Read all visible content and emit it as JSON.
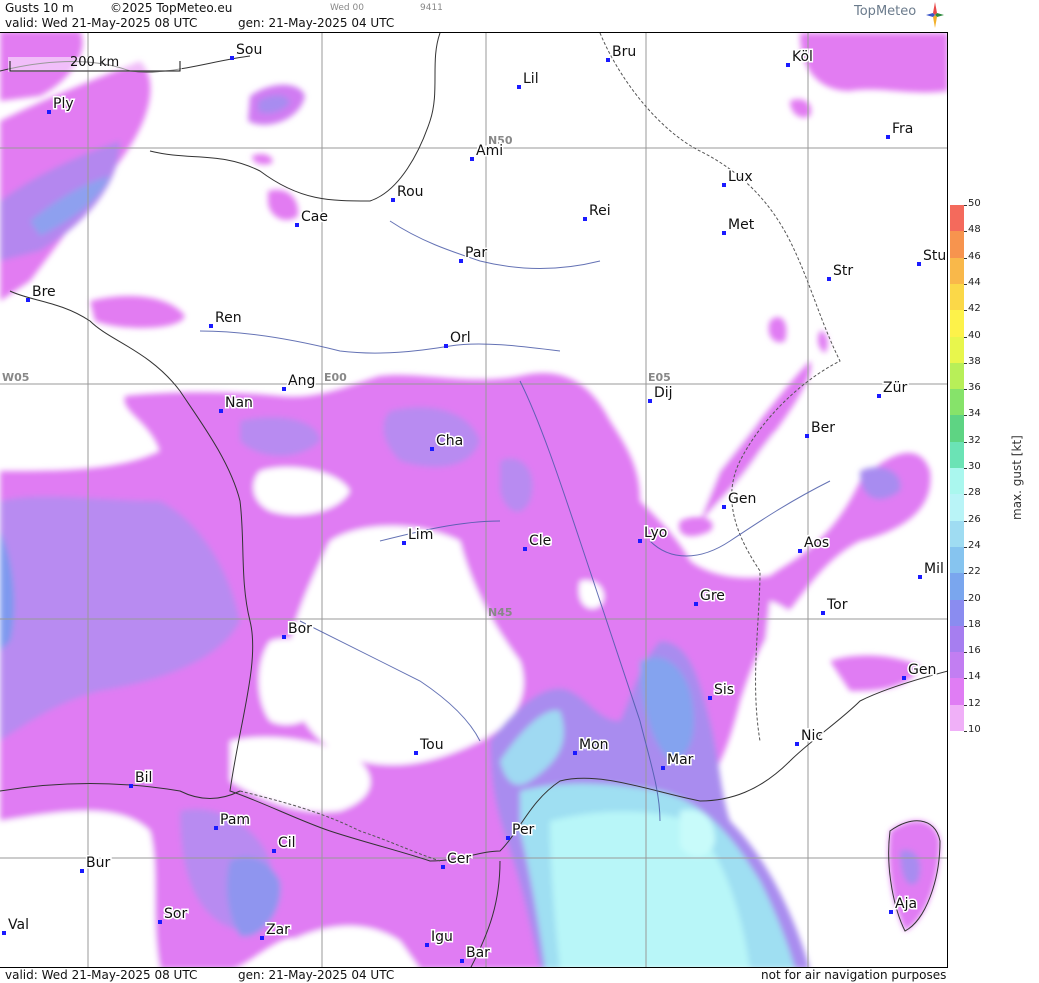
{
  "header": {
    "product": "Gusts 10 m",
    "copyright": "©2025 TopMeteo.eu",
    "run_label": "Wed 00",
    "run_id": "9411",
    "valid": "valid:  Wed  21-May-2025  08 UTC",
    "generated": "gen: 21-May-2025 04 UTC",
    "brand": "TopMeteo"
  },
  "scale_bar": {
    "label": "200 km"
  },
  "grid_labels": {
    "lat50": "N50",
    "lat45": "N45",
    "lon_w05": "W05",
    "lon_e00": "E00",
    "lon_e05": "E05"
  },
  "cities": [
    {
      "name": "Sou"
    },
    {
      "name": "Bru"
    },
    {
      "name": "Köl"
    },
    {
      "name": "Lil"
    },
    {
      "name": "Ply"
    },
    {
      "name": "Ami"
    },
    {
      "name": "Fra"
    },
    {
      "name": "Rou"
    },
    {
      "name": "Lux"
    },
    {
      "name": "Cae"
    },
    {
      "name": "Rei"
    },
    {
      "name": "Met"
    },
    {
      "name": "Par"
    },
    {
      "name": "Stu"
    },
    {
      "name": "Str"
    },
    {
      "name": "Bre"
    },
    {
      "name": "Ren"
    },
    {
      "name": "Orl"
    },
    {
      "name": "Ang"
    },
    {
      "name": "Dij"
    },
    {
      "name": "Zür"
    },
    {
      "name": "Nan"
    },
    {
      "name": "Ber"
    },
    {
      "name": "Cha"
    },
    {
      "name": "Gen"
    },
    {
      "name": "Lim"
    },
    {
      "name": "Cle"
    },
    {
      "name": "Lyo"
    },
    {
      "name": "Aos"
    },
    {
      "name": "Mil"
    },
    {
      "name": "Gre"
    },
    {
      "name": "Bor"
    },
    {
      "name": "Tor"
    },
    {
      "name": "Gen"
    },
    {
      "name": "Sis"
    },
    {
      "name": "Tou"
    },
    {
      "name": "Mon"
    },
    {
      "name": "Nic"
    },
    {
      "name": "Mar"
    },
    {
      "name": "Bil"
    },
    {
      "name": "Pam"
    },
    {
      "name": "Per"
    },
    {
      "name": "Cil"
    },
    {
      "name": "Cer"
    },
    {
      "name": "Bur"
    },
    {
      "name": "Aja"
    },
    {
      "name": "Sor"
    },
    {
      "name": "Val"
    },
    {
      "name": "Zar"
    },
    {
      "name": "Igu"
    },
    {
      "name": "Bar"
    }
  ],
  "legend": {
    "title": "max. gust  [kt]",
    "ticks": [
      "50",
      "48",
      "46",
      "44",
      "42",
      "40",
      "38",
      "36",
      "34",
      "32",
      "30",
      "28",
      "26",
      "24",
      "22",
      "20",
      "18",
      "16",
      "14",
      "12",
      "10"
    ],
    "colors": [
      "#f46a5c",
      "#f7944e",
      "#f9b84a",
      "#fbd848",
      "#fdf24a",
      "#e8f64c",
      "#b8ef58",
      "#86e36a",
      "#5ed483",
      "#6be3b5",
      "#aaf7ee",
      "#b9f4f7",
      "#9fdcf2",
      "#86c4ef",
      "#7aa6ee",
      "#8a8cf0",
      "#a67ef0",
      "#c27ef2",
      "#e07df4",
      "#f0b0f8"
    ]
  },
  "footer": {
    "valid": "valid:  Wed  21-May-2025  08 UTC",
    "generated": "gen: 21-May-2025 04 UTC",
    "disclaimer": "not for air navigation purposes"
  },
  "palette": {
    "light_pink": "#ea7bf0",
    "pink": "#d47cf2",
    "violet": "#a884ef",
    "blue": "#7f95ef",
    "cyan": "#9fe4f3",
    "pale_cyan": "#b8f7f9"
  }
}
